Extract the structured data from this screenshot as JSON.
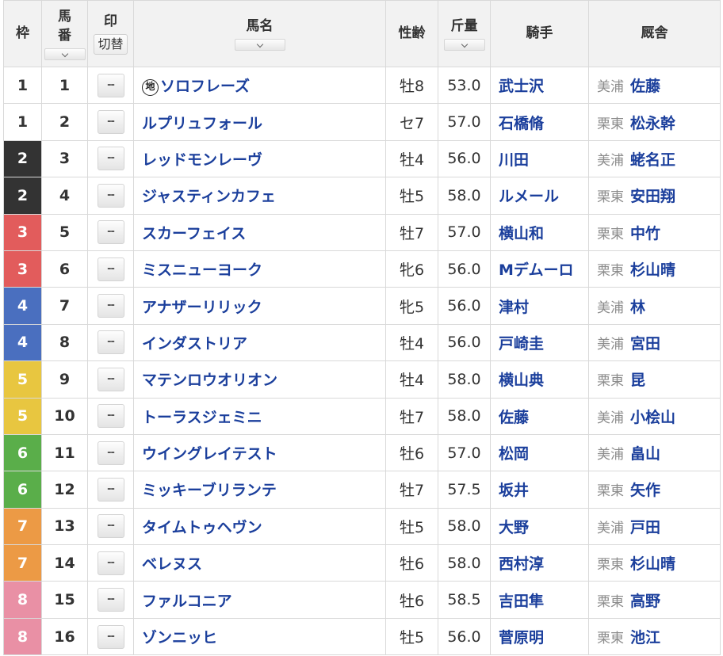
{
  "header": {
    "waku": "枠",
    "umaban": "馬番",
    "mark": "印",
    "mark_toggle": "切替",
    "horse": "馬名",
    "sexage": "性齢",
    "weight": "斤量",
    "jockey": "騎手",
    "trainer": "厩舎"
  },
  "mark_placeholder": "--",
  "icons": {
    "local_horse": "地"
  },
  "waku_colors": {
    "1": "#ffffff",
    "2": "#333333",
    "3": "#e25c5c",
    "4": "#4a6fbf",
    "5": "#e8c640",
    "6": "#5aae4a",
    "7": "#ec9a45",
    "8": "#e990a5"
  },
  "entries": [
    {
      "waku": "1",
      "umaban": "1",
      "horse": "ソロフレーズ",
      "local": true,
      "sexage": "牡8",
      "weight": "53.0",
      "jockey": "武士沢",
      "region": "美浦",
      "trainer": "佐藤"
    },
    {
      "waku": "1",
      "umaban": "2",
      "horse": "ルプリュフォール",
      "local": false,
      "sexage": "セ7",
      "weight": "57.0",
      "jockey": "石橋脩",
      "region": "栗東",
      "trainer": "松永幹"
    },
    {
      "waku": "2",
      "umaban": "3",
      "horse": "レッドモンレーヴ",
      "local": false,
      "sexage": "牡4",
      "weight": "56.0",
      "jockey": "川田",
      "region": "美浦",
      "trainer": "蛯名正"
    },
    {
      "waku": "2",
      "umaban": "4",
      "horse": "ジャスティンカフェ",
      "local": false,
      "sexage": "牡5",
      "weight": "58.0",
      "jockey": "ルメール",
      "region": "栗東",
      "trainer": "安田翔"
    },
    {
      "waku": "3",
      "umaban": "5",
      "horse": "スカーフェイス",
      "local": false,
      "sexage": "牡7",
      "weight": "57.0",
      "jockey": "横山和",
      "region": "栗東",
      "trainer": "中竹"
    },
    {
      "waku": "3",
      "umaban": "6",
      "horse": "ミスニューヨーク",
      "local": false,
      "sexage": "牝6",
      "weight": "56.0",
      "jockey": "Mデムーロ",
      "region": "栗東",
      "trainer": "杉山晴"
    },
    {
      "waku": "4",
      "umaban": "7",
      "horse": "アナザーリリック",
      "local": false,
      "sexage": "牝5",
      "weight": "56.0",
      "jockey": "津村",
      "region": "美浦",
      "trainer": "林"
    },
    {
      "waku": "4",
      "umaban": "8",
      "horse": "インダストリア",
      "local": false,
      "sexage": "牡4",
      "weight": "56.0",
      "jockey": "戸崎圭",
      "region": "美浦",
      "trainer": "宮田"
    },
    {
      "waku": "5",
      "umaban": "9",
      "horse": "マテンロウオリオン",
      "local": false,
      "sexage": "牡4",
      "weight": "58.0",
      "jockey": "横山典",
      "region": "栗東",
      "trainer": "昆"
    },
    {
      "waku": "5",
      "umaban": "10",
      "horse": "トーラスジェミニ",
      "local": false,
      "sexage": "牡7",
      "weight": "58.0",
      "jockey": "佐藤",
      "region": "美浦",
      "trainer": "小桧山"
    },
    {
      "waku": "6",
      "umaban": "11",
      "horse": "ウイングレイテスト",
      "local": false,
      "sexage": "牡6",
      "weight": "57.0",
      "jockey": "松岡",
      "region": "美浦",
      "trainer": "畠山"
    },
    {
      "waku": "6",
      "umaban": "12",
      "horse": "ミッキーブリランテ",
      "local": false,
      "sexage": "牡7",
      "weight": "57.5",
      "jockey": "坂井",
      "region": "栗東",
      "trainer": "矢作"
    },
    {
      "waku": "7",
      "umaban": "13",
      "horse": "タイムトゥヘヴン",
      "local": false,
      "sexage": "牡5",
      "weight": "58.0",
      "jockey": "大野",
      "region": "美浦",
      "trainer": "戸田"
    },
    {
      "waku": "7",
      "umaban": "14",
      "horse": "ベレヌス",
      "local": false,
      "sexage": "牡6",
      "weight": "58.0",
      "jockey": "西村淳",
      "region": "栗東",
      "trainer": "杉山晴"
    },
    {
      "waku": "8",
      "umaban": "15",
      "horse": "ファルコニア",
      "local": false,
      "sexage": "牡6",
      "weight": "58.5",
      "jockey": "吉田隼",
      "region": "栗東",
      "trainer": "高野"
    },
    {
      "waku": "8",
      "umaban": "16",
      "horse": "ゾンニッヒ",
      "local": false,
      "sexage": "牡5",
      "weight": "56.0",
      "jockey": "菅原明",
      "region": "栗東",
      "trainer": "池江"
    }
  ]
}
